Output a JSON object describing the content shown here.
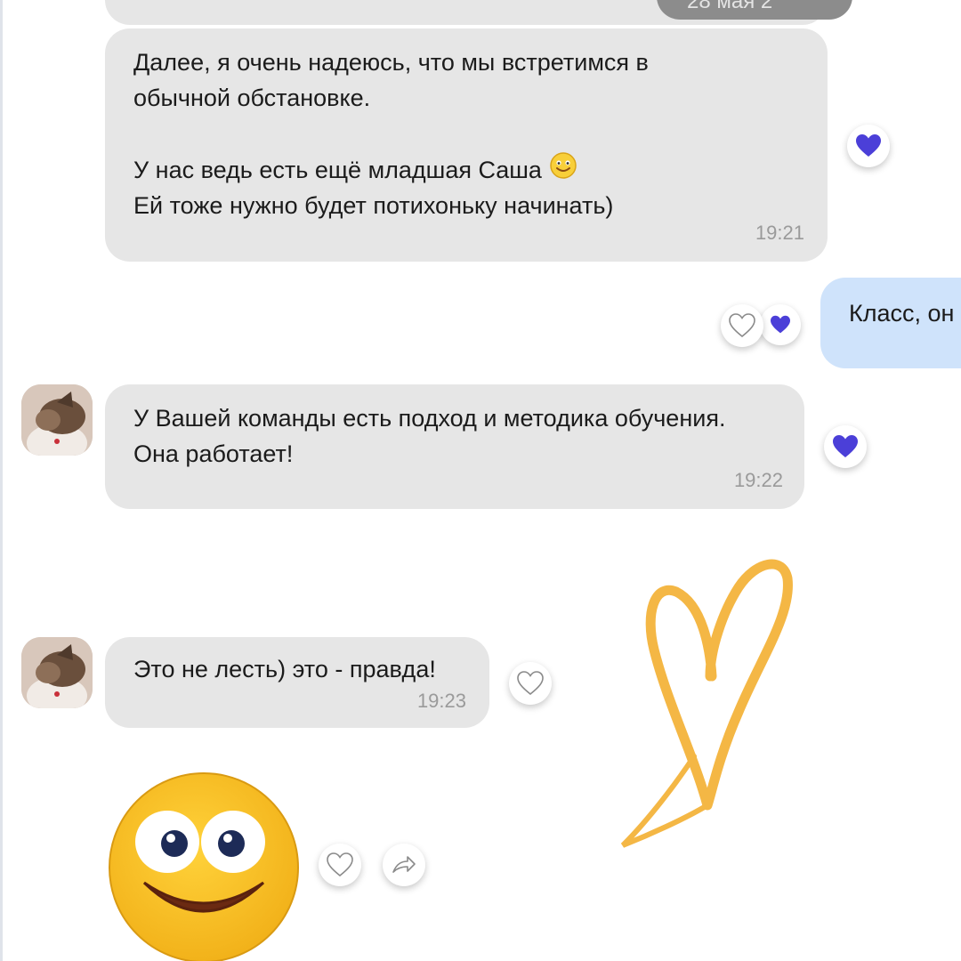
{
  "date_pill": "28 мая 2",
  "messages": [
    {
      "direction": "incoming",
      "text": "Далее, я очень надеюсь, что мы встретимся в\nобычной обстановке.\n\nУ нас ведь есть ещё младшая Саша",
      "text_line2": "Ей тоже нужно будет потихоньку начинать)",
      "time": "19:21",
      "reaction": "liked-heart-icon"
    },
    {
      "direction": "outgoing",
      "text": "Класс, он",
      "reaction": "heart-outline-icon + liked-heart-icon"
    },
    {
      "direction": "incoming",
      "text": "У Вашей команды есть подход и методика обучения.\nОна работает!",
      "time": "19:22",
      "reaction": "liked-heart-icon"
    },
    {
      "direction": "incoming",
      "text": "Это не лесть) это - правда!",
      "time": "19:23",
      "reaction": "heart-outline-icon"
    }
  ],
  "sticker": "smiley-sticker",
  "colors": {
    "incoming_bubble": "#e6e6e6",
    "outgoing_bubble": "#cfe3fb",
    "like_heart": "#4b3fd8",
    "deco_heart": "#f4b745",
    "smiley_face": "#f6bd22"
  }
}
